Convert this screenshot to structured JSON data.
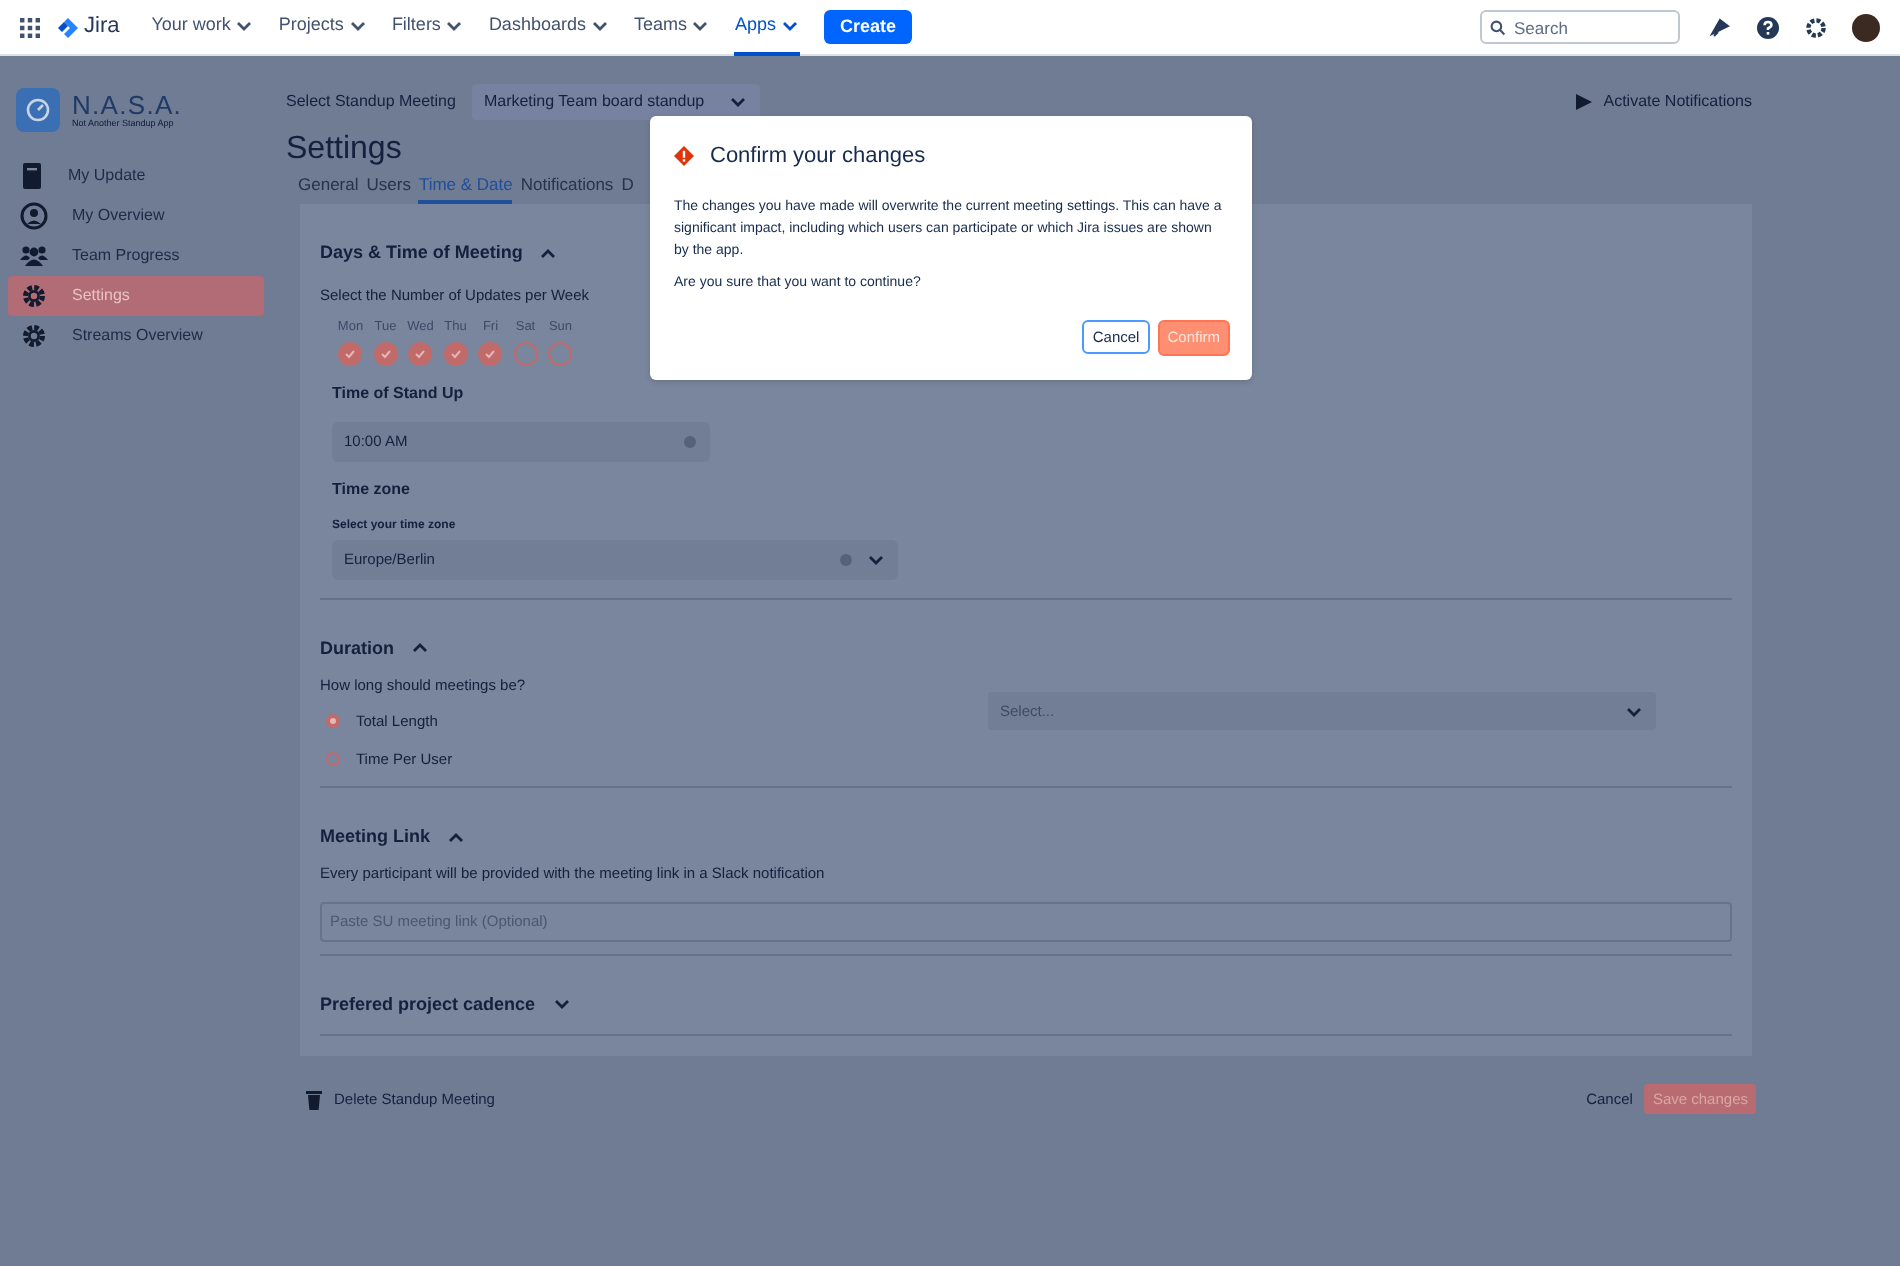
{
  "topnav": {
    "product": "Jira",
    "items": [
      {
        "label": "Your work",
        "selected": false
      },
      {
        "label": "Projects",
        "selected": false
      },
      {
        "label": "Filters",
        "selected": false
      },
      {
        "label": "Dashboards",
        "selected": false
      },
      {
        "label": "Teams",
        "selected": false
      },
      {
        "label": "Apps",
        "selected": true
      }
    ],
    "create": "Create",
    "search": {
      "placeholder": "Search"
    }
  },
  "sidebar": {
    "logo": {
      "title": "N.A.S.A.",
      "subtitle": "Not Another Standup App"
    },
    "items": [
      {
        "label": "My Update",
        "kind": "note",
        "selected": false
      },
      {
        "label": "My Overview",
        "kind": "person",
        "selected": false
      },
      {
        "label": "Team Progress",
        "kind": "team",
        "selected": false
      },
      {
        "label": "Settings",
        "kind": "gear",
        "selected": true
      },
      {
        "label": "Streams Overview",
        "kind": "gear",
        "selected": false
      }
    ]
  },
  "meeting_select": {
    "label": "Select Standup Meeting",
    "value": "Marketing Team board standup"
  },
  "activate_notifications": "Activate Notifications",
  "title": "Settings",
  "tabs": [
    {
      "label": "General",
      "selected": false
    },
    {
      "label": "Users",
      "selected": false
    },
    {
      "label": "Time & Date",
      "selected": true
    },
    {
      "label": "Notifications",
      "selected": false
    },
    {
      "label": "D",
      "selected": false
    }
  ],
  "days_section": {
    "title": "Days & Time of Meeting",
    "expanded": true,
    "prompt": "Select the Number of Updates per Week",
    "days": [
      {
        "label": "Mon",
        "checked": true
      },
      {
        "label": "Tue",
        "checked": true
      },
      {
        "label": "Wed",
        "checked": true
      },
      {
        "label": "Thu",
        "checked": true
      },
      {
        "label": "Fri",
        "checked": true
      },
      {
        "label": "Sat",
        "checked": false
      },
      {
        "label": "Sun",
        "checked": false
      }
    ],
    "time_label": "Time of Stand Up",
    "time_value": "10:00 AM",
    "timezone_label": "Time zone",
    "timezone_sublabel": "Select your time zone",
    "timezone_value": "Europe/Berlin"
  },
  "duration_section": {
    "title": "Duration",
    "expanded": true,
    "prompt": "How long should meetings be?",
    "options": [
      {
        "label": "Total Length",
        "selected": true
      },
      {
        "label": "Time Per User",
        "selected": false
      }
    ],
    "select_placeholder": "Select..."
  },
  "link_section": {
    "title": "Meeting Link",
    "expanded": true,
    "description": "Every participant will be provided with the meeting link in a Slack notification",
    "placeholder": "Paste SU meeting link (Optional)"
  },
  "cadence_section": {
    "title": "Prefered project cadence",
    "expanded": false
  },
  "footer": {
    "delete": "Delete Standup Meeting",
    "cancel": "Cancel",
    "save": "Save changes"
  },
  "dialog": {
    "title": "Confirm your changes",
    "body": "The changes you have made will overwrite the current meeting settings. This can have a significant impact, including which users can participate or which Jira issues are shown by the app.",
    "question": "Are you sure that you want to continue?",
    "cancel": "Cancel",
    "confirm": "Confirm"
  }
}
